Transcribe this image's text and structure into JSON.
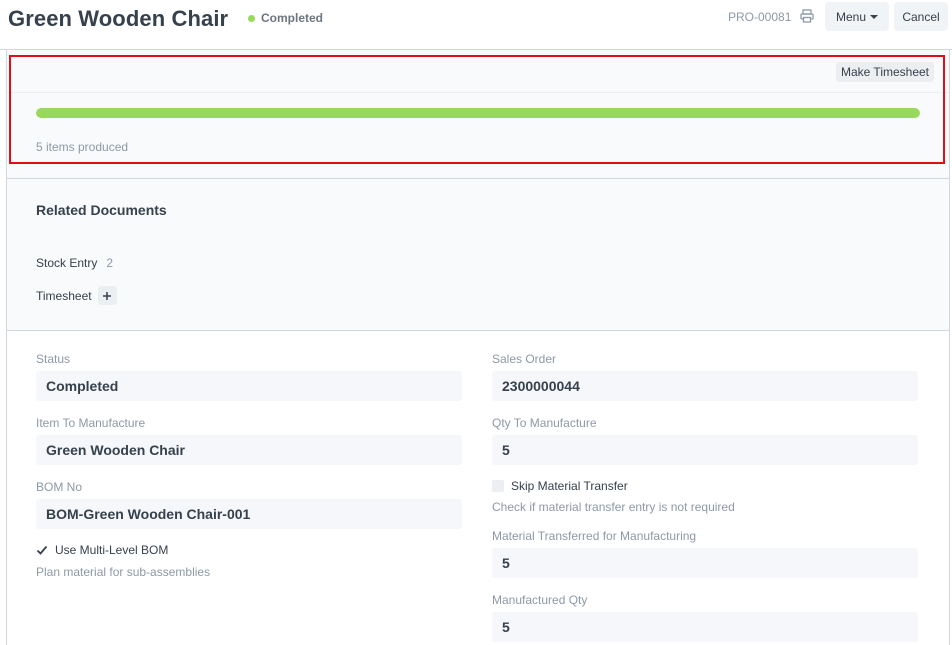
{
  "header": {
    "title": "Green Wooden Chair",
    "status": "Completed",
    "status_color": "#98d85b",
    "doc_name": "PRO-00081",
    "print_icon": "printer-icon",
    "menu_label": "Menu",
    "cancel_label": "Cancel"
  },
  "progress": {
    "button_label": "Make Timesheet",
    "fraction": 1.0,
    "bar_color": "#98d85b",
    "message": "5 items produced"
  },
  "related": {
    "heading": "Related Documents",
    "items": [
      {
        "label": "Stock Entry",
        "count": "2"
      },
      {
        "label": "Timesheet",
        "add_icon": "plus-icon"
      }
    ]
  },
  "form": {
    "status": {
      "label": "Status",
      "value": "Completed"
    },
    "item": {
      "label": "Item To Manufacture",
      "value": "Green Wooden Chair"
    },
    "bom": {
      "label": "BOM No",
      "value": "BOM-Green Wooden Chair-001"
    },
    "multi_level": {
      "label": "Use Multi-Level BOM",
      "checked": true,
      "help": "Plan material for sub-assemblies"
    },
    "sales_order": {
      "label": "Sales Order",
      "value": "2300000044"
    },
    "qty": {
      "label": "Qty To Manufacture",
      "value": "5"
    },
    "skip_transfer": {
      "label": "Skip Material Transfer",
      "checked": false,
      "help": "Check if material transfer entry is not required"
    },
    "transferred": {
      "label": "Material Transferred for Manufacturing",
      "value": "5"
    },
    "manufactured": {
      "label": "Manufactured Qty",
      "value": "5"
    }
  }
}
